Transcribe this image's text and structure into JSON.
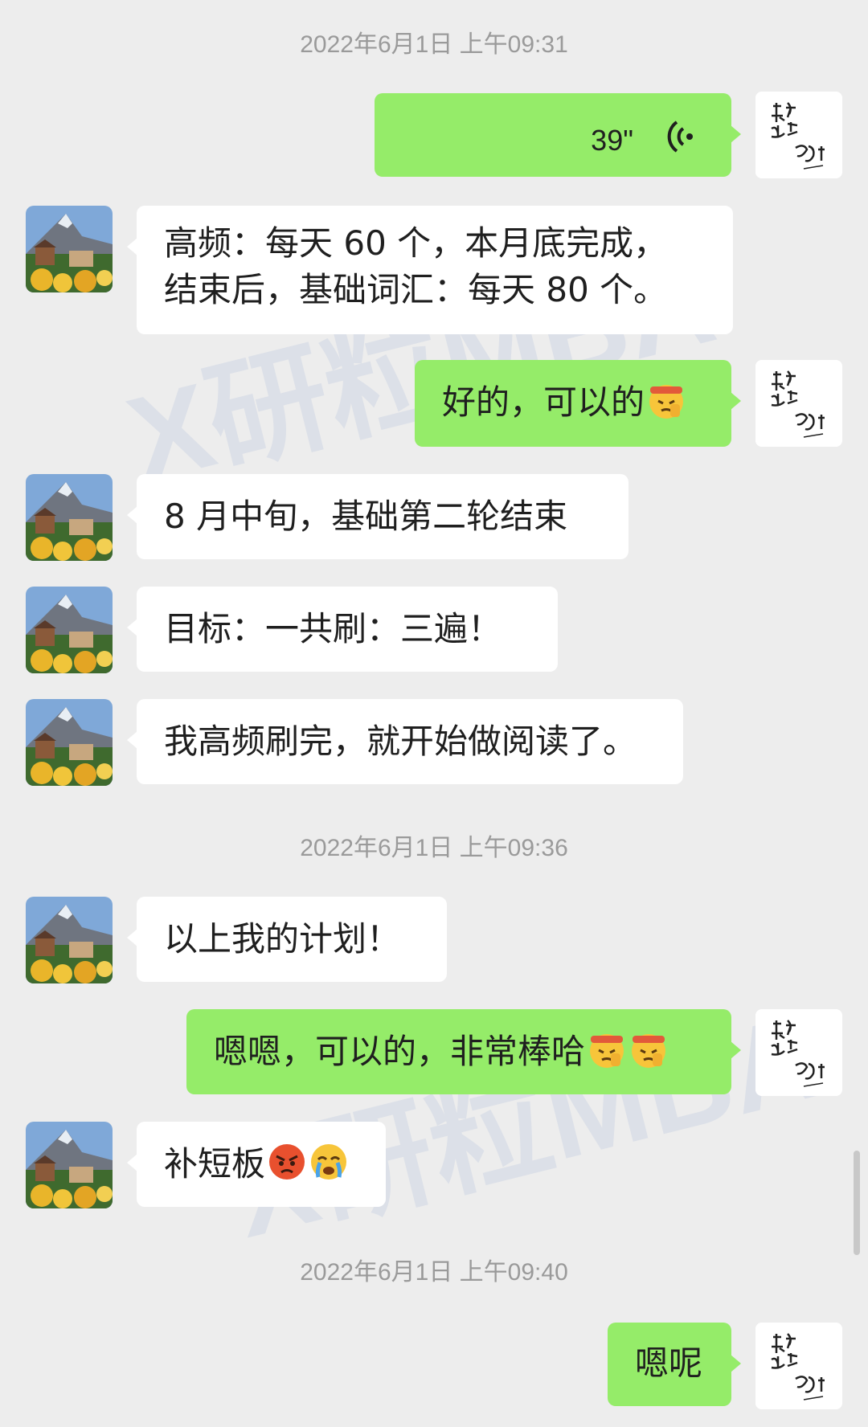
{
  "timestamps": [
    "2022年6月1日 上午09:31",
    "2022年6月1日 上午09:36",
    "2022年6月1日 上午09:40"
  ],
  "messages": {
    "m1_voice": {
      "duration": "39\""
    },
    "m2": {
      "line1": "高频：每天 60 个，本月底完成，",
      "line2": "结束后，基础词汇：每天 80 个。"
    },
    "m3": {
      "text": "好的，可以的"
    },
    "m4": {
      "text": "8 月中旬，基础第二轮结束"
    },
    "m5": {
      "text": "目标：一共刷：三遍！"
    },
    "m6": {
      "text": "我高频刷完，就开始做阅读了。"
    },
    "m7": {
      "text": "以上我的计划！"
    },
    "m8": {
      "text": "嗯嗯，可以的，非常棒哈"
    },
    "m9": {
      "text": "补短板"
    },
    "m10": {
      "text": "嗯呢"
    }
  },
  "watermark": {
    "text": "研粒MBA",
    "mark": "X"
  },
  "colors": {
    "background": "#ededed",
    "sent_bubble": "#95ec69",
    "received_bubble": "#ffffff",
    "timestamp": "#9a9a9a"
  },
  "icons": [
    "voice-wave-icon",
    "salute-emoji-icon",
    "angry-emoji-icon",
    "crying-emoji-icon"
  ]
}
